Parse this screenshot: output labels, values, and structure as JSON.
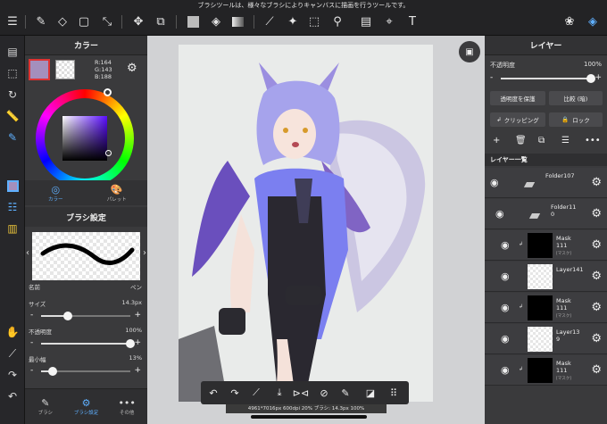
{
  "tooltip": "ブラシツールは、様々なブラシによりキャンバスに描画を行うツールです。",
  "icons": {
    "top": [
      "menu-icon",
      "brush-icon",
      "eraser-icon",
      "rect-select-icon",
      "magic-wand-icon",
      "move-icon",
      "transform-icon",
      "fill-color-icon",
      "bucket-icon",
      "gradient-icon",
      "pen-icon",
      "auto-select-icon",
      "lasso-icon",
      "eyedropper-icon",
      "select-pen-icon",
      "frame-icon",
      "text-icon",
      "materials-icon",
      "layers-icon"
    ]
  },
  "color_panel": {
    "title": "カラー",
    "r": "R:164",
    "g": "G:143",
    "b": "B:188",
    "main_color": "#a48fbc",
    "tab_color": "カラー",
    "tab_palette": "パレット"
  },
  "brush_panel": {
    "title": "ブラシ設定",
    "name_label": "名前",
    "name_value": "ペン",
    "size_label": "サイズ",
    "size_value": "14.3px",
    "size_fraction": 0.3,
    "opacity_label": "不透明度",
    "opacity_value": "100%",
    "opacity_fraction": 1.0,
    "minwidth_label": "最小幅",
    "minwidth_value": "13%",
    "minwidth_fraction": 0.13,
    "tabs": [
      "ブラシ",
      "ブラシ設定",
      "その他"
    ]
  },
  "status": "4961*7016px 600dpi 20% ブラシ: 14.3px 100%",
  "layer_panel": {
    "title": "レイヤー",
    "opacity_label": "不透明度",
    "opacity_value": "100%",
    "opacity_fraction": 1.0,
    "protect_label": "透明度を保護",
    "blend_label": "比較 (暗)",
    "clipping_label": "クリッピング",
    "lock_label": "ロック",
    "list_label": "レイヤー一覧",
    "layers": [
      {
        "name": "Folder107",
        "kind": "folder",
        "tag": ""
      },
      {
        "name": "Folder11\n0",
        "kind": "folder",
        "tag": ""
      },
      {
        "name": "Mask\n111",
        "kind": "mask",
        "tag": "[マスク]"
      },
      {
        "name": "Layer141",
        "kind": "layer",
        "tag": ""
      },
      {
        "name": "Mask\n111",
        "kind": "mask",
        "tag": "[マスク]"
      },
      {
        "name": "Layer13\n9",
        "kind": "layer",
        "tag": ""
      },
      {
        "name": "Mask\n111",
        "kind": "mask",
        "tag": "[マスク]"
      }
    ]
  }
}
